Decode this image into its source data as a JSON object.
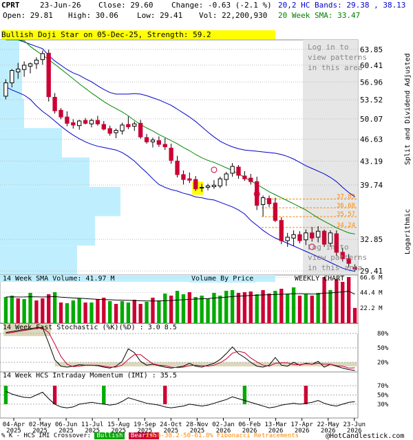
{
  "header": {
    "symbol": "CPRT",
    "date": "23-Jun-26",
    "close_label": "Close: 29.60",
    "change_label": "Change: -0.63 (-2.1 %)",
    "open_label": "Open: 29.81",
    "high_label": "High: 30.06",
    "low_label": "Low: 29.41",
    "vol_label": "Vol: 22,200,930",
    "bands_label": "20,2 HC Bands: 29.38 , 38.13",
    "sma_label": "20 Week SMA: 33.47"
  },
  "pattern_banner": "Bullish Doji Star on 05-Dec-25, Strength: 59.2",
  "login_text": [
    "Log in to",
    "view patterns",
    "in this area"
  ],
  "right_axis_title": "Split and Dividend Adjusted",
  "log_label": "Logarithmic",
  "colors": {
    "bull": "#00aa00",
    "bear": "#cc0033",
    "sma": "#008800",
    "band": "#0000cc",
    "vbp": "#bfefff",
    "fib": "#ff8800",
    "panel_shade": "#ddd8bb",
    "grey_area": "#e6e6e6"
  },
  "chart_data": [
    {
      "type": "candlestick",
      "title": "CPRT weekly",
      "y_scale": "log",
      "ylim": [
        29.0,
        66.0
      ],
      "y_ticks": [
        "63.85",
        "60.41",
        "56.96",
        "53.52",
        "50.07",
        "46.63",
        "43.19",
        "39.74",
        "32.85",
        "29.41"
      ],
      "fib_levels": [
        {
          "label": "37.83",
          "value": 37.83
        },
        {
          "label": "36.68",
          "value": 36.68
        },
        {
          "label": "35.57",
          "value": 35.57
        },
        {
          "label": "34.24",
          "value": 34.24
        }
      ],
      "x_labels": [
        "04-Apr\n2025",
        "02-May\n2025",
        "06-Jun\n2025",
        "11-Jul\n2025",
        "15-Aug\n2025",
        "19-Sep\n2025",
        "24-Oct\n2025",
        "28-Nov\n2025",
        "02-Jan\n2026",
        "06-Feb\n2026",
        "13-Mar\n2026",
        "17-Apr\n2026",
        "22-May\n2026",
        "23-Jun\n2026"
      ],
      "candles": [
        {
          "o": 54.2,
          "h": 57.5,
          "l": 53.6,
          "c": 56.8
        },
        {
          "o": 56.8,
          "h": 59.6,
          "l": 55.9,
          "c": 59.3
        },
        {
          "o": 59.0,
          "h": 60.9,
          "l": 57.6,
          "c": 59.6
        },
        {
          "o": 59.5,
          "h": 61.2,
          "l": 58.0,
          "c": 60.4
        },
        {
          "o": 60.2,
          "h": 61.0,
          "l": 58.7,
          "c": 60.7
        },
        {
          "o": 60.7,
          "h": 62.1,
          "l": 59.6,
          "c": 61.5
        },
        {
          "o": 61.6,
          "h": 63.6,
          "l": 60.5,
          "c": 62.9
        },
        {
          "o": 63.0,
          "h": 63.8,
          "l": 53.2,
          "c": 54.1
        },
        {
          "o": 54.0,
          "h": 54.8,
          "l": 51.0,
          "c": 51.5
        },
        {
          "o": 51.6,
          "h": 52.0,
          "l": 50.0,
          "c": 50.4
        },
        {
          "o": 50.4,
          "h": 51.4,
          "l": 48.8,
          "c": 49.3
        },
        {
          "o": 49.4,
          "h": 50.0,
          "l": 48.4,
          "c": 49.0
        },
        {
          "o": 48.9,
          "h": 49.9,
          "l": 48.2,
          "c": 49.7
        },
        {
          "o": 49.8,
          "h": 50.2,
          "l": 49.1,
          "c": 49.3
        },
        {
          "o": 49.2,
          "h": 50.1,
          "l": 48.6,
          "c": 49.8
        },
        {
          "o": 49.8,
          "h": 50.6,
          "l": 48.9,
          "c": 49.2
        },
        {
          "o": 49.1,
          "h": 49.7,
          "l": 48.1,
          "c": 48.3
        },
        {
          "o": 48.4,
          "h": 48.9,
          "l": 47.2,
          "c": 47.6
        },
        {
          "o": 47.7,
          "h": 48.4,
          "l": 46.8,
          "c": 48.1
        },
        {
          "o": 48.0,
          "h": 49.4,
          "l": 47.4,
          "c": 49.0
        },
        {
          "o": 49.1,
          "h": 50.5,
          "l": 48.3,
          "c": 48.7
        },
        {
          "o": 48.8,
          "h": 49.6,
          "l": 48.0,
          "c": 49.2
        },
        {
          "o": 49.3,
          "h": 49.9,
          "l": 46.7,
          "c": 47.0
        },
        {
          "o": 46.9,
          "h": 47.5,
          "l": 45.9,
          "c": 46.2
        },
        {
          "o": 46.2,
          "h": 46.9,
          "l": 45.3,
          "c": 46.5
        },
        {
          "o": 46.4,
          "h": 47.1,
          "l": 45.4,
          "c": 45.8
        },
        {
          "o": 45.8,
          "h": 46.8,
          "l": 44.9,
          "c": 45.4
        },
        {
          "o": 45.2,
          "h": 45.9,
          "l": 42.8,
          "c": 43.3
        },
        {
          "o": 43.2,
          "h": 44.0,
          "l": 40.8,
          "c": 41.2
        },
        {
          "o": 41.2,
          "h": 41.8,
          "l": 39.8,
          "c": 40.5
        },
        {
          "o": 40.6,
          "h": 41.5,
          "l": 40.0,
          "c": 40.4
        },
        {
          "o": 40.5,
          "h": 41.0,
          "l": 38.9,
          "c": 39.2
        },
        {
          "o": 39.3,
          "h": 39.9,
          "l": 38.8,
          "c": 39.4
        },
        {
          "o": 39.4,
          "h": 39.9,
          "l": 39.0,
          "c": 39.6
        },
        {
          "o": 39.5,
          "h": 40.4,
          "l": 39.2,
          "c": 39.7
        },
        {
          "o": 39.6,
          "h": 40.9,
          "l": 39.3,
          "c": 40.6
        },
        {
          "o": 40.5,
          "h": 41.6,
          "l": 39.6,
          "c": 41.3
        },
        {
          "o": 41.4,
          "h": 42.9,
          "l": 40.9,
          "c": 42.4
        },
        {
          "o": 42.3,
          "h": 42.6,
          "l": 40.6,
          "c": 41.1
        },
        {
          "o": 41.0,
          "h": 41.7,
          "l": 40.3,
          "c": 40.6
        },
        {
          "o": 40.7,
          "h": 41.3,
          "l": 39.8,
          "c": 40.2
        },
        {
          "o": 40.2,
          "h": 40.9,
          "l": 36.4,
          "c": 37.0
        },
        {
          "o": 37.1,
          "h": 38.3,
          "l": 35.6,
          "c": 38.0
        },
        {
          "o": 37.9,
          "h": 38.3,
          "l": 36.8,
          "c": 37.2
        },
        {
          "o": 37.3,
          "h": 38.0,
          "l": 34.9,
          "c": 35.1
        },
        {
          "o": 35.1,
          "h": 35.5,
          "l": 32.3,
          "c": 32.7
        },
        {
          "o": 32.7,
          "h": 33.6,
          "l": 32.0,
          "c": 33.1
        },
        {
          "o": 33.0,
          "h": 33.9,
          "l": 32.1,
          "c": 33.4
        },
        {
          "o": 33.4,
          "h": 33.8,
          "l": 32.4,
          "c": 32.7
        },
        {
          "o": 32.8,
          "h": 34.0,
          "l": 32.2,
          "c": 33.6
        },
        {
          "o": 33.6,
          "h": 34.3,
          "l": 32.6,
          "c": 33.0
        },
        {
          "o": 33.1,
          "h": 34.4,
          "l": 32.5,
          "c": 33.8
        },
        {
          "o": 33.8,
          "h": 34.0,
          "l": 32.0,
          "c": 32.3
        },
        {
          "o": 32.4,
          "h": 33.9,
          "l": 32.0,
          "c": 33.6
        },
        {
          "o": 33.5,
          "h": 33.9,
          "l": 31.0,
          "c": 31.4
        },
        {
          "o": 31.4,
          "h": 31.9,
          "l": 30.4,
          "c": 30.7
        },
        {
          "o": 30.7,
          "h": 31.2,
          "l": 29.8,
          "c": 30.2
        },
        {
          "o": 29.8,
          "h": 30.1,
          "l": 29.4,
          "c": 29.6
        }
      ],
      "sma20": [
        70,
        68.5,
        67,
        65.8,
        64.5,
        63.5,
        62.6,
        61.6,
        60.6,
        59.6,
        58.6,
        57.6,
        56.6,
        55.7,
        54.8,
        54.0,
        53.2,
        52.5,
        51.9,
        51.3,
        50.6,
        49.8,
        49.1,
        48.5,
        48.0,
        47.4,
        46.9,
        46.4,
        45.9,
        45.3,
        44.8,
        44.2,
        43.7,
        43.3,
        43.0,
        42.6,
        42.2,
        41.8,
        41.3,
        40.8,
        40.3,
        39.8,
        39.3,
        38.8,
        38.4,
        38.0,
        37.6,
        37.2,
        36.8,
        36.4,
        35.9,
        35.4,
        35.0,
        34.6,
        34.2,
        33.9,
        33.6,
        33.47
      ],
      "band_upper": [
        66,
        66,
        66,
        65.5,
        65,
        64.5,
        64,
        62.5,
        61.3,
        60.4,
        59.5,
        58.8,
        58.3,
        57.6,
        57.0,
        56.2,
        55.5,
        54.9,
        54.6,
        54.6,
        54.6,
        54.7,
        54.6,
        54.3,
        53.9,
        53.5,
        53.0,
        52.5,
        51.8,
        51.1,
        50.4,
        49.6,
        48.7,
        47.8,
        47.0,
        46.3,
        45.8,
        45.4,
        45.1,
        44.9,
        44.8,
        44.7,
        44.6,
        44.5,
        44.4,
        44.2,
        43.9,
        43.5,
        43.0,
        42.5,
        42.1,
        41.7,
        41.3,
        40.8,
        40.2,
        39.4,
        38.7,
        38.13
      ],
      "band_lower": [
        56,
        55.4,
        54.9,
        54.4,
        53.6,
        52.4,
        51.4,
        50.6,
        49.7,
        48.8,
        48.0,
        47.3,
        46.7,
        46.2,
        45.8,
        45.5,
        45.3,
        45.1,
        44.9,
        44.5,
        43.9,
        43.2,
        42.3,
        41.5,
        40.6,
        39.8,
        39.4,
        39.1,
        38.9,
        38.6,
        38.4,
        38.1,
        38.0,
        37.8,
        37.7,
        37.4,
        37.1,
        36.8,
        36.4,
        35.9,
        35.1,
        34.5,
        33.9,
        33.4,
        33.0,
        32.7,
        32.4,
        32.1,
        31.8,
        31.5,
        31.2,
        30.9,
        30.6,
        30.3,
        30.0,
        29.7,
        29.5,
        29.38
      ]
    },
    {
      "type": "bar",
      "title": "14 Week SMA Volume: 41.97 M",
      "overlay_label": "Volume By Price",
      "right_label": "WEEKLY CHART",
      "y_ticks": [
        "66.6 M",
        "44.4 M",
        "22.2 M"
      ],
      "ylim": [
        0,
        70
      ],
      "values": [
        38,
        40,
        36,
        35,
        44,
        33,
        36,
        42,
        45,
        30,
        29,
        33,
        36,
        30,
        30,
        35,
        37,
        32,
        28,
        32,
        30,
        34,
        28,
        31,
        37,
        33,
        43,
        40,
        47,
        42,
        45,
        38,
        40,
        36,
        44,
        40,
        47,
        48,
        44,
        45,
        46,
        42,
        48,
        43,
        47,
        50,
        43,
        52,
        40,
        42,
        40,
        44,
        67,
        48,
        64,
        60,
        67,
        22
      ],
      "bullish": [
        true,
        true,
        false,
        true,
        true,
        false,
        false,
        false,
        true,
        false,
        true,
        true,
        true,
        false,
        true,
        false,
        false,
        true,
        false,
        true,
        true,
        false,
        false,
        true,
        false,
        true,
        true,
        false,
        true,
        true,
        false,
        true,
        true,
        true,
        true,
        true,
        true,
        true,
        false,
        false,
        false,
        true,
        false,
        false,
        true,
        false,
        true,
        true,
        false,
        true,
        false,
        true,
        false,
        true,
        false,
        false,
        false,
        false
      ],
      "sma": [
        38,
        38.2,
        38,
        38.1,
        38.4,
        38.2,
        38,
        38.2,
        38.6,
        37.8,
        37.2,
        36.6,
        36.3,
        35.7,
        35.1,
        34.6,
        34.2,
        34.0,
        33.6,
        33.4,
        33.1,
        32.9,
        32.5,
        32.3,
        32.2,
        32.2,
        32.6,
        32.9,
        33.6,
        34.0,
        34.6,
        35.0,
        35.4,
        35.8,
        36.5,
        37.0,
        37.9,
        38.6,
        39.2,
        39.6,
        40.3,
        40.6,
        41.1,
        41.3,
        41.6,
        42.1,
        42.3,
        42.8,
        42.7,
        42.6,
        42.3,
        42.4,
        43.8,
        43.9,
        44.8,
        45.4,
        46.5,
        41.97
      ]
    },
    {
      "type": "line",
      "title": "14 Week Fast Stochastic (%K)(%D) : 3.0 8.5",
      "y_ticks": [
        "80%",
        "50%",
        "20%"
      ],
      "ylim": [
        0,
        100
      ],
      "k": [
        82,
        84,
        86,
        88,
        90,
        92,
        92,
        60,
        25,
        12,
        10,
        12,
        15,
        14,
        14,
        13,
        10,
        8,
        12,
        22,
        48,
        40,
        22,
        14,
        16,
        13,
        10,
        8,
        10,
        12,
        18,
        12,
        10,
        14,
        18,
        26,
        38,
        52,
        38,
        30,
        20,
        12,
        10,
        14,
        30,
        14,
        12,
        20,
        14,
        18,
        16,
        22,
        10,
        16,
        12,
        8,
        5,
        3
      ],
      "d": [
        80,
        82,
        84,
        86,
        88,
        90,
        91,
        82,
        58,
        32,
        16,
        11,
        12,
        14,
        14,
        14,
        12,
        10,
        10,
        14,
        26,
        36,
        36,
        26,
        17,
        14,
        13,
        10,
        9,
        10,
        13,
        14,
        13,
        12,
        14,
        19,
        27,
        39,
        43,
        40,
        29,
        21,
        14,
        12,
        18,
        19,
        19,
        15,
        15,
        17,
        16,
        18,
        16,
        16,
        13,
        12,
        8,
        8.5
      ]
    },
    {
      "type": "line",
      "title": "14 Week HCS Intraday Momentum (IMI) : 35.5",
      "y_ticks": [
        "70%",
        "50%",
        "30%"
      ],
      "ylim": [
        0,
        100
      ],
      "values": [
        58,
        52,
        48,
        45,
        44,
        50,
        56,
        42,
        30,
        24,
        22,
        24,
        30,
        32,
        34,
        32,
        30,
        28,
        30,
        36,
        44,
        40,
        36,
        32,
        30,
        28,
        24,
        22,
        24,
        26,
        30,
        28,
        26,
        28,
        32,
        36,
        40,
        46,
        42,
        38,
        34,
        30,
        26,
        22,
        24,
        28,
        30,
        32,
        30,
        32,
        34,
        38,
        32,
        28,
        26,
        30,
        34,
        35.5
      ],
      "crossover_bullish": [
        0,
        16,
        39
      ],
      "crossover_bearish": [
        8,
        26,
        49
      ]
    }
  ],
  "footer": {
    "legend_prefix": "% K - HCS IMI Crossover:",
    "bullish": "Bullish",
    "bearish": "Bearish",
    "fib_text": "23.6-38.2-50-61.8% Fibonacci Retracements",
    "copyright": "@HotCandlestick.com"
  }
}
